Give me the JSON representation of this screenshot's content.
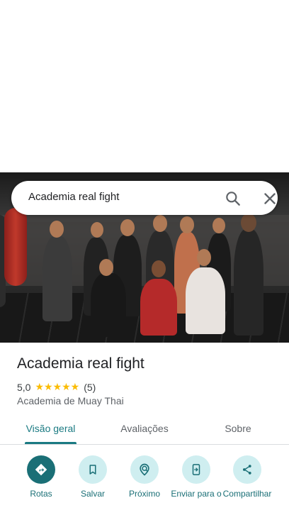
{
  "search": {
    "query": "Academia real fight"
  },
  "place": {
    "name": "Academia real fight",
    "rating": "5,0",
    "stars": "★★★★★",
    "review_count": "(5)",
    "category": "Academia de Muay Thai"
  },
  "tabs": [
    {
      "label": "Visão geral",
      "active": true
    },
    {
      "label": "Avaliações",
      "active": false
    },
    {
      "label": "Sobre",
      "active": false
    }
  ],
  "actions": [
    {
      "label": "Rotas",
      "icon": "directions-icon"
    },
    {
      "label": "Salvar",
      "icon": "bookmark-icon"
    },
    {
      "label": "Próximo",
      "icon": "nearby-icon"
    },
    {
      "label": "Enviar para o",
      "icon": "send-to-phone-icon"
    },
    {
      "label": "Compartilhar",
      "icon": "share-icon"
    }
  ],
  "colors": {
    "accent": "#1a7a82",
    "action_bg": "#cfeef0",
    "star": "#fbbc04"
  }
}
